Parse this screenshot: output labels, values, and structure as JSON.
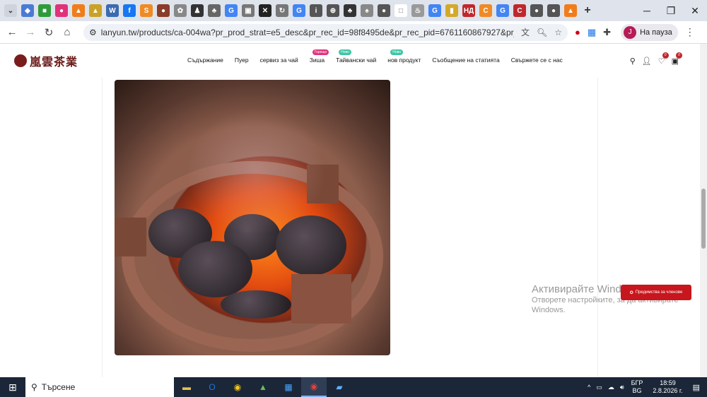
{
  "browser": {
    "tab_icons": [
      {
        "name": "tab-icon-1",
        "color": "#4a7bd4",
        "glyph": "◆"
      },
      {
        "name": "tab-icon-2",
        "color": "#2e9b3b",
        "glyph": "■"
      },
      {
        "name": "tab-icon-3",
        "color": "#e0337a",
        "glyph": "●"
      },
      {
        "name": "tab-icon-4",
        "color": "#f07d1a",
        "glyph": "▲"
      },
      {
        "name": "tab-icon-5",
        "color": "#c9a227",
        "glyph": "▲"
      },
      {
        "name": "tab-icon-6",
        "color": "#3b6ab0",
        "glyph": "W"
      },
      {
        "name": "tab-icon-7",
        "color": "#1877f2",
        "glyph": "f"
      },
      {
        "name": "tab-icon-8",
        "color": "#f08a24",
        "glyph": "S"
      },
      {
        "name": "tab-icon-9",
        "color": "#8a3b2a",
        "glyph": "●"
      },
      {
        "name": "tab-icon-10",
        "color": "#888888",
        "glyph": "✿"
      },
      {
        "name": "tab-icon-11",
        "color": "#333333",
        "glyph": "♟"
      },
      {
        "name": "tab-icon-12",
        "color": "#666666",
        "glyph": "♣"
      },
      {
        "name": "tab-icon-13",
        "color": "#4285f4",
        "glyph": "G"
      },
      {
        "name": "tab-icon-14",
        "color": "#777777",
        "glyph": "▣"
      },
      {
        "name": "tab-icon-15",
        "color": "#222222",
        "glyph": "✕"
      },
      {
        "name": "tab-icon-16",
        "color": "#777777",
        "glyph": "↻"
      },
      {
        "name": "tab-icon-17",
        "color": "#4285f4",
        "glyph": "G"
      },
      {
        "name": "tab-icon-18",
        "color": "#555555",
        "glyph": "i"
      },
      {
        "name": "tab-icon-19",
        "color": "#555555",
        "glyph": "⊕"
      },
      {
        "name": "tab-icon-20",
        "color": "#333333",
        "glyph": "♣"
      },
      {
        "name": "tab-icon-21",
        "color": "#888888",
        "glyph": "♠"
      },
      {
        "name": "tab-icon-22",
        "color": "#555555",
        "glyph": "●"
      },
      {
        "name": "tab-icon-23",
        "color": "#ffffff",
        "glyph": "□"
      },
      {
        "name": "tab-icon-24",
        "color": "#999999",
        "glyph": "♨"
      },
      {
        "name": "tab-icon-25",
        "color": "#4285f4",
        "glyph": "G"
      },
      {
        "name": "tab-icon-26",
        "color": "#d4a92a",
        "glyph": "▮"
      },
      {
        "name": "tab-icon-27",
        "color": "#c0272d",
        "glyph": "НД"
      },
      {
        "name": "tab-icon-28",
        "color": "#f08a24",
        "glyph": "C"
      },
      {
        "name": "tab-icon-29",
        "color": "#4285f4",
        "glyph": "G"
      },
      {
        "name": "tab-icon-30",
        "color": "#c0272d",
        "glyph": "C"
      },
      {
        "name": "tab-icon-31",
        "color": "#555555",
        "glyph": "●"
      },
      {
        "name": "tab-icon-32",
        "color": "#555555",
        "glyph": "●"
      },
      {
        "name": "tab-icon-33",
        "color": "#f07d1a",
        "glyph": "▲"
      }
    ],
    "new_tab": "+",
    "window": {
      "minimize": "─",
      "restore": "❐",
      "close": "✕"
    },
    "nav": {
      "back": "←",
      "forward": "→",
      "reload": "↻",
      "home": "⌂"
    },
    "url": "lanyun.tw/products/ca-004wa?pr_prod_strat=e5_desc&pr_rec_id=98f8495de&pr_rec_pid=6761160867927&pr_ref_pid=67611...",
    "profile_initial": "J",
    "profile_label": "На пауза"
  },
  "site": {
    "logo_text": "嵐雲茶業",
    "menu": [
      {
        "label": "Съдържание",
        "badge": ""
      },
      {
        "label": "Пуер",
        "badge": ""
      },
      {
        "label": "сервиз за чай",
        "badge": ""
      },
      {
        "label": "Зиша",
        "badge": "Горещо",
        "badge_color": "#e0337a"
      },
      {
        "label": "Тайвански чай",
        "badge": "Ново",
        "badge_color": "#3fc5a5"
      },
      {
        "label": "нов продукт",
        "badge": "Ново",
        "badge_color": "#3fc5a5"
      },
      {
        "label": "Съобщение на статията",
        "badge": ""
      },
      {
        "label": "Свържете се с нас",
        "badge": ""
      }
    ],
    "wishlist_count": "0",
    "cart_count": "0",
    "chat_button": "Предимства за членове"
  },
  "watermark": {
    "title": "Активирайте Windows",
    "subtitle": "Отворете настройките, за да активирате Windows."
  },
  "taskbar": {
    "search_placeholder": "Търсене",
    "lang_top": "БГР",
    "lang_bottom": "BG",
    "time": "18:59",
    "date": "2.8.2026 г."
  }
}
